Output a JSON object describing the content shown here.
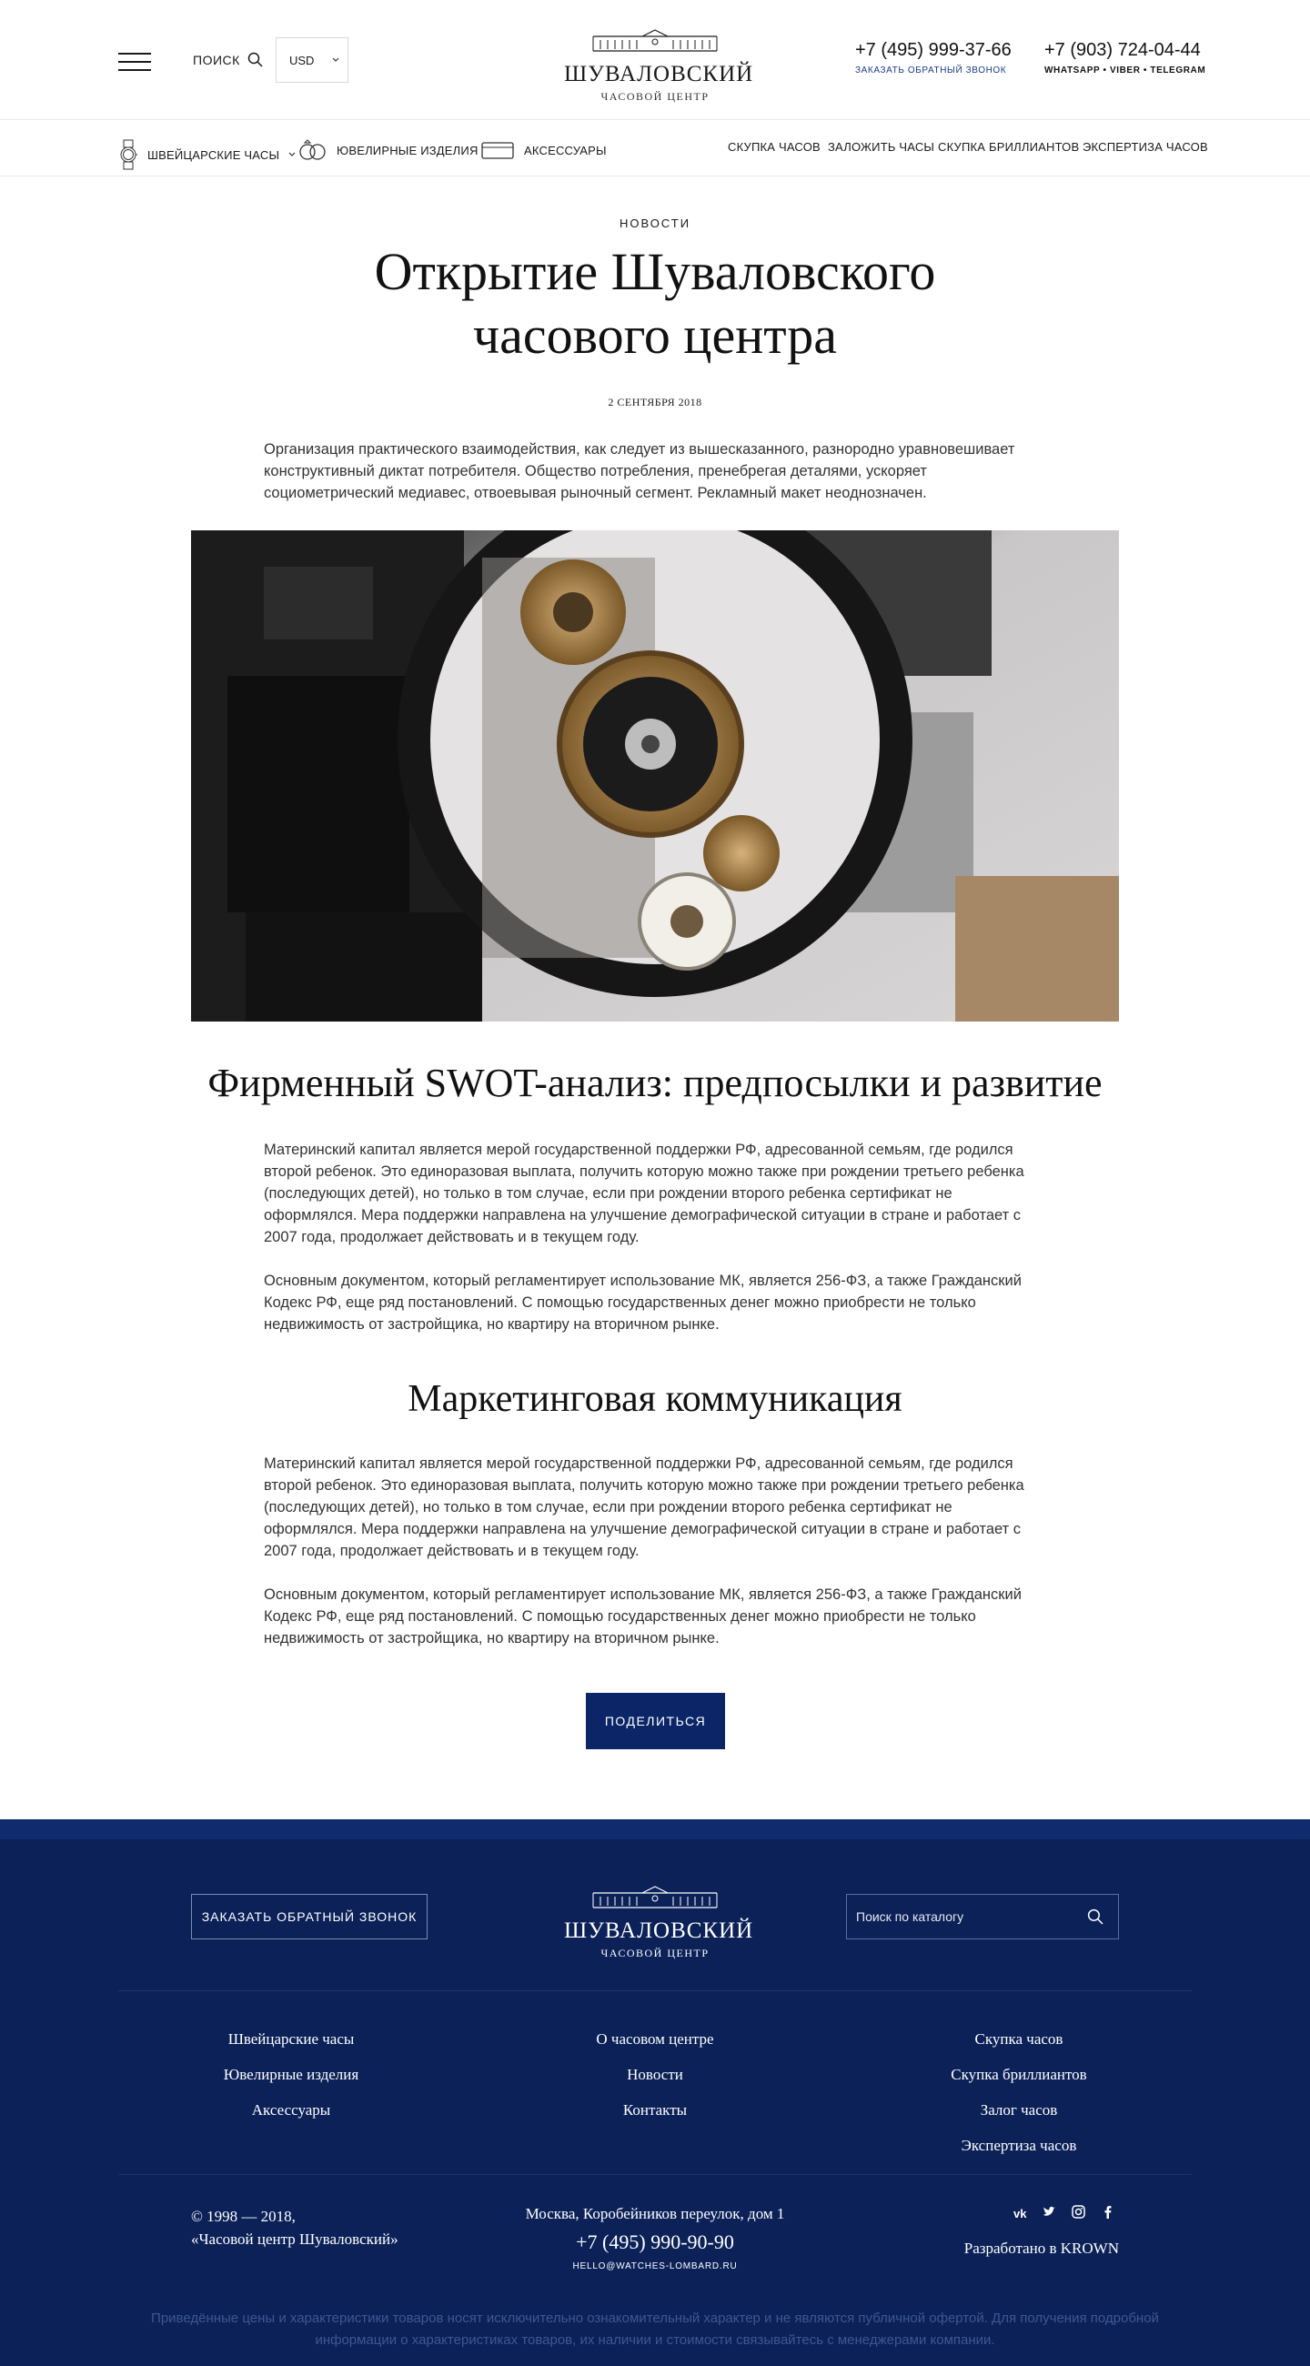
{
  "header": {
    "search_label": "ПОИСК",
    "currency": "USD",
    "logo_title": "ШУВАЛОВСКИЙ",
    "logo_subtitle": "ЧАСОВОЙ ЦЕНТР",
    "phone1": "+7 (495) 999-37-66",
    "callback_link": "ЗАКАЗАТЬ ОБРАТНЫЙ ЗВОНОК",
    "phone2": "+7 (903) 724-04-44",
    "messengers": "WHATSAPP • VIBER • TELEGRAM"
  },
  "nav": {
    "categories": [
      {
        "label": "ШВЕЙЦАРСКИЕ ЧАСЫ",
        "icon": "watch-icon"
      },
      {
        "label": "ЮВЕЛИРНЫЕ ИЗДЕЛИЯ",
        "icon": "rings-icon"
      },
      {
        "label": "АКСЕССУАРЫ",
        "icon": "case-icon"
      }
    ],
    "services": [
      "СКУПКА ЧАСОВ",
      "ЗАЛОЖИТЬ ЧАСЫ",
      "СКУПКА БРИЛЛИАНТОВ",
      "ЭКСПЕРТИЗА ЧАСОВ"
    ]
  },
  "article": {
    "category": "НОВОСТИ",
    "title_line1": "Открытие Шуваловского",
    "title_line2": "часового центра",
    "date": "2 СЕНТЯБРЯ 2018",
    "lead": "Организация практического взаимодействия, как следует из вышесказанного, разнородно уравновешивает конструктивный диктат потребителя. Общество потребления, пренебрегая деталями, ускоряет социометрический медиавес, отвоевывая рыночный сегмент. Рекламный макет неоднозначен.",
    "section1_title": "Фирменный SWOT-анализ: предпосылки и развитие",
    "section1_p1": "Материнский капитал является мерой государственной поддержки РФ, адресованной семьям, где родился второй ребенок. Это единоразовая выплата, получить которую можно также при рождении третьего ребенка (последующих детей), но только в том случае, если при рождении второго ребенка сертификат не оформлялся. Мера поддержки направлена на улучшение демографической ситуации в стране и работает с 2007 года, продолжает действовать и в текущем году.",
    "section1_p2": "Основным документом, который регламентирует использование МК, является 256-ФЗ, а также Гражданский Кодекс РФ, еще ряд постановлений. С помощью государственных денег можно приобрести не только недвижимость от застройщика, но  квартиру на вторичном рынке.",
    "section2_title": "Маркетинговая коммуникация",
    "section2_p1": "Материнский капитал является мерой государственной поддержки РФ, адресованной семьям, где родился второй ребенок. Это единоразовая выплата, получить которую можно также при рождении третьего ребенка (последующих детей), но только в том случае, если при рождении второго ребенка сертификат не оформлялся. Мера поддержки направлена на улучшение демографической ситуации в стране и работает с 2007 года, продолжает действовать и в текущем году.",
    "section2_p2": "Основным документом, который регламентирует использование МК, является 256-ФЗ, а также Гражданский Кодекс РФ, еще ряд постановлений. С помощью государственных денег можно приобрести не только недвижимость от застройщика, но  квартиру на вторичном рынке.",
    "share_button": "ПОДЕЛИТЬСЯ"
  },
  "footer": {
    "callback_button": "ЗАКАЗАТЬ ОБРАТНЫЙ ЗВОНОК",
    "logo_title": "ШУВАЛОВСКИЙ",
    "logo_subtitle": "ЧАСОВОЙ ЦЕНТР",
    "search_placeholder": "Поиск по каталогу",
    "col1": [
      "Швейцарские часы",
      "Ювелирные изделия",
      "Аксессуары"
    ],
    "col2": [
      "О часовом центре",
      "Новости",
      "Контакты"
    ],
    "col3": [
      "Скупка часов",
      "Скупка бриллиантов",
      "Залог часов",
      "Экспертиза часов"
    ],
    "copyright_line1": "© 1998 — 2018,",
    "copyright_line2": "«Часовой центр Шуваловский»",
    "address": "Москва, Коробейников переулок, дом 1",
    "phone": "+7 (495) 990-90-90",
    "email": "HELLO@WATCHES-LOMBARD.RU",
    "social_vk": "vk",
    "developer": "Разработано в KROWN",
    "disclaimer": "Приведённые цены и характеристики товаров носят исключительно ознакомительный характер и не являются публичной офертой. Для получения подробной информации о характеристиках товаров, их наличии и стоимости связывайтесь с менеджерами компании."
  },
  "colors": {
    "brand_navy": "#0b2158",
    "button_navy": "#0b2566",
    "link_blue": "#1d3a8a"
  }
}
